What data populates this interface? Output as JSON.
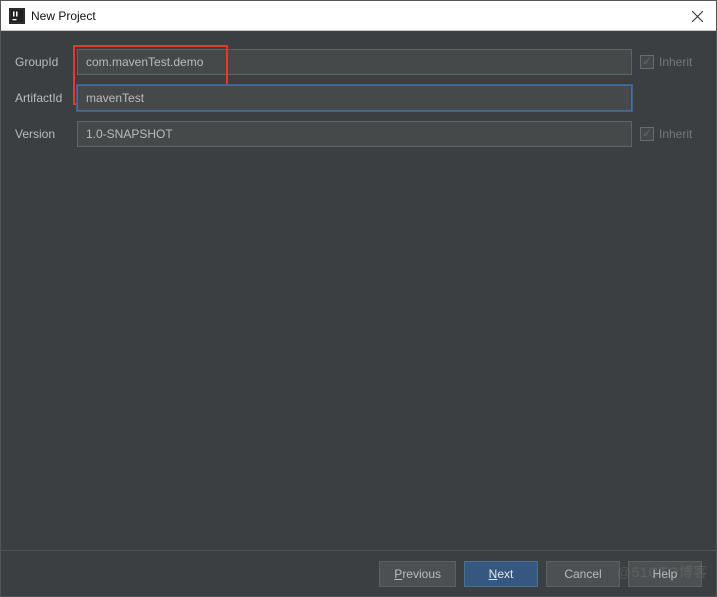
{
  "window": {
    "title": "New Project"
  },
  "fields": {
    "groupId": {
      "label": "GroupId",
      "value": "com.mavenTest.demo"
    },
    "artifactId": {
      "label": "ArtifactId",
      "value": "mavenTest"
    },
    "version": {
      "label": "Version",
      "value": "1.0-SNAPSHOT"
    }
  },
  "inherit": {
    "label": "Inherit",
    "checkmark": "✓"
  },
  "buttons": {
    "previous": "Previous",
    "next": "Next",
    "cancel": "Cancel",
    "help": "Help"
  },
  "watermark": "@51CTO博客"
}
